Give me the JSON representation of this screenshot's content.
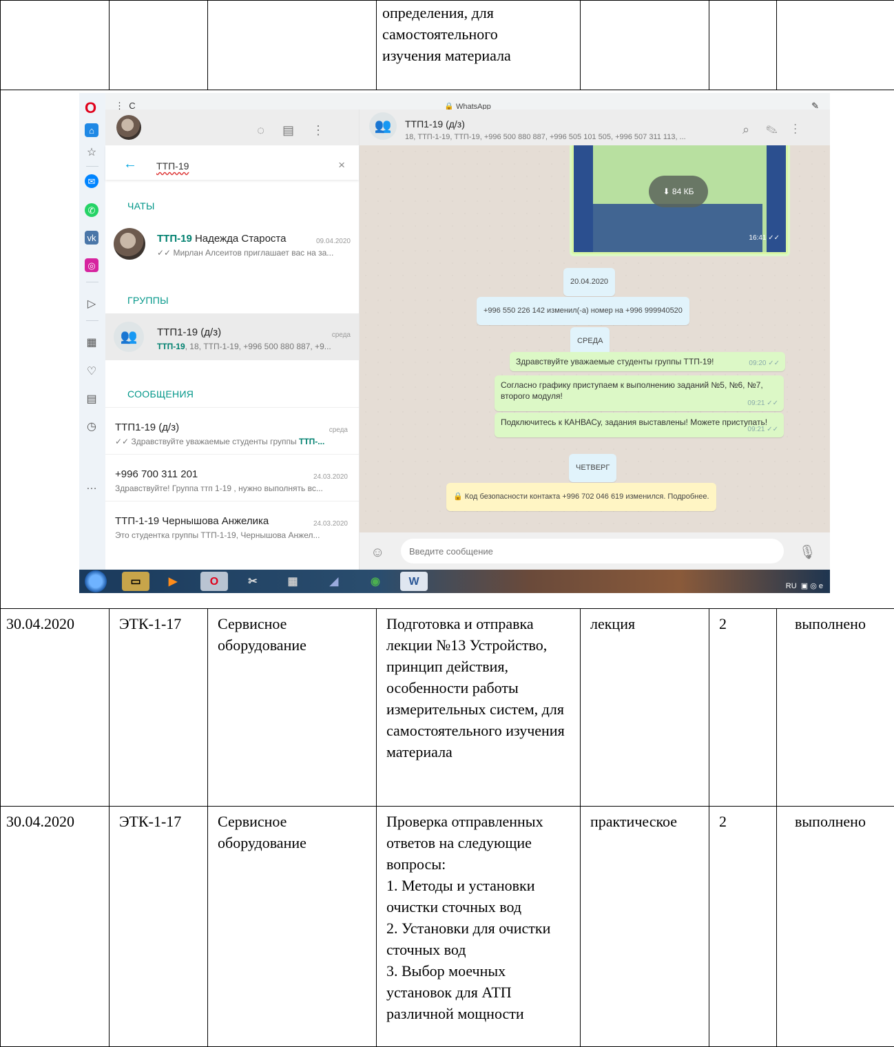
{
  "top_row": {
    "c4": [
      "определения, для",
      "самостоятельного",
      "изучения материала"
    ]
  },
  "screenshot": {
    "browser": {
      "title": "WhatsApp",
      "sidebar_icons": [
        "opera-logo",
        "home-icon",
        "star-icon",
        "messenger-icon",
        "whatsapp-icon",
        "vk-icon",
        "instagram-icon",
        "send-icon",
        "grid-icon",
        "heart-icon",
        "news-icon",
        "history-icon",
        "more-icon"
      ]
    },
    "left": {
      "search_query": "ТТП-19",
      "sections": {
        "chats": "ЧАТЫ",
        "groups": "ГРУППЫ",
        "messages": "СООБЩЕНИЯ"
      },
      "chat_item": {
        "highlight": "ТТП-19",
        "name_rest": " Надежда Староста",
        "date": "09.04.2020",
        "preview": "✓✓ Мирлан Алсеитов приглашает вас на за..."
      },
      "group_item": {
        "name": "ТТП1-19 (д/з)",
        "date": "среда",
        "highlight": "ТТП-19",
        "preview_rest": ", 18, ТТП-1-19, +996 500 880 887, +9..."
      },
      "messages": [
        {
          "name": "ТТП1-19 (д/з)",
          "date": "среда",
          "preview": "✓✓ Здравствуйте уважаемые студенты группы ",
          "highlight": "ТТП-..."
        },
        {
          "name": "+996 700 311 201",
          "date": "24.03.2020",
          "preview": "Здравствуйте! Группа ттп 1-19 , нужно выполнять вс...",
          "highlight": ""
        },
        {
          "name": "ТТП-1-19 Чернышова Анжелика",
          "date": "24.03.2020",
          "preview": "Это студентка группы ТТП-1-19, Чернышова Анжел...",
          "highlight": ""
        }
      ]
    },
    "right": {
      "chat_title": "ТТП1-19 (д/з)",
      "chat_sub": "18, ТТП-1-19, ТТП-19, +996 500 880 887, +996 505 101 505, +996 507 311 113, ...",
      "image_size": "84 КБ",
      "image_time": "16:41",
      "date_chip": "20.04.2020",
      "system_change": "+996 550 226 142 изменил(-а) номер на +996 999940520",
      "day_chip": "СРЕДА",
      "out_messages": [
        {
          "text": "Здравствуйте уважаемые студенты группы ТТП-19!",
          "time": "09:20"
        },
        {
          "text": "Согласно графику приступаем к выполнению заданий №5, №6, №7, второго модуля!",
          "time": "09:21"
        },
        {
          "text": "Подключитесь к КАНВАСу, задания выставлены! Можете приступать!",
          "time": "09:21"
        }
      ],
      "day_chip2": "ЧЕТВЕРГ",
      "security": "🔒 Код безопасности контакта +996 702 046 619 изменился. Подробнее.",
      "composer_placeholder": "Введите сообщение"
    },
    "taskbar": {
      "tray": "RU"
    }
  },
  "rows": [
    {
      "date": "30.04.2020",
      "group": "ЭТК-1-17",
      "subject": "Сервисное оборудование",
      "topic": "Подготовка и отправка лекции №13 Устройство, принцип действия, особенности работы измерительных систем, для самостоятельного изучения материала",
      "type": "лекция",
      "hours": "2",
      "status": "выполнено"
    },
    {
      "date": "30.04.2020",
      "group": "ЭТК-1-17",
      "subject": "Сервисное оборудование",
      "topic": "Проверка отправленных ответов на следующие вопросы:\n1. Методы и установки очистки сточных вод\n2. Установки для очистки сточных вод\n 3. Выбор моечных установок для АТП различной мощности",
      "type": "практическое",
      "hours": "2",
      "status": "выполнено"
    }
  ]
}
